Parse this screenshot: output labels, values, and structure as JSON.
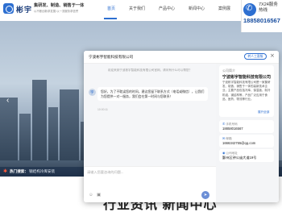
{
  "header": {
    "logo_text": "彬宇",
    "slogan": "集研发、制造、销售于一体",
    "slogan_sub": "以不断创新求发展 以一流服务求信誉",
    "nav": [
      "首页",
      "关于我们",
      "产品中心",
      "新闻中心",
      "案例展"
    ],
    "active_index": 0
  },
  "service": {
    "title": "7X24服务热线",
    "phone": "18858016567"
  },
  "hero": {
    "prev_icon": "chevron-left-icon",
    "next_icon": "chevron-right-icon",
    "hot_label": "热门搜索：",
    "hot_text": "钢结构冷库安装",
    "bottom_title": "行业资讯 新闻中心"
  },
  "chat": {
    "title": "宁波彬宇智能科技有限公司",
    "human_button": "转人工客服",
    "close_glyph": "×",
    "system_message": "欢迎来到宁波彬宇智能科技有限公司官网，请问有什么可以帮您？",
    "bubble": "您好，为了不耽误您的时间，建议您留下联系方式（电话或微信），让我们为您提供一对一服务，我们会在第一时间与您联系！",
    "time": "10:00:11",
    "input_placeholder": "请输入您要咨询的问题...",
    "send_glyph": "➤"
  },
  "company": {
    "label": "公司简介",
    "name": "宁波彬宇智能科技有限公司",
    "desc": "宁波彬宇智能科技有限公司是一家集研发、制造、销售于一体的高新技术企业，主要产品包括冷库、保温板、制冷机组、钢结构等，产品广泛应用于食品、医药、物流等行业。",
    "more": "展开全部"
  },
  "contacts": [
    {
      "label": "手机号码",
      "value": "18858016567",
      "icon": "phone-icon"
    },
    {
      "label": "邮箱",
      "value": "1666342755@qq.com",
      "icon": "mail-icon"
    },
    {
      "label": "公司地址",
      "value": "鄞州区钟公庙大道19号",
      "icon": "location-icon"
    }
  ],
  "colors": {
    "accent": "#2d6fd1",
    "hot": "#ff5a3c"
  }
}
